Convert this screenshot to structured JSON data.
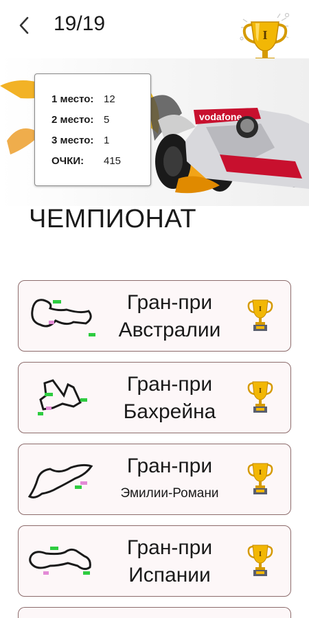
{
  "header": {
    "counter": "19/19"
  },
  "stats": [
    {
      "label": "1 место:",
      "value": "12"
    },
    {
      "label": "2 место:",
      "value": "5"
    },
    {
      "label": "3 место:",
      "value": "1"
    },
    {
      "label": "ОЧКИ:",
      "value": "415"
    }
  ],
  "hero": {
    "car_text": "vodafone"
  },
  "title": "ЧЕМПИОНАТ",
  "trophy_numeral": "I",
  "races": [
    {
      "line1": "Гран-при",
      "line2": "Австралии"
    },
    {
      "line1": "Гран-при",
      "line2": "Бахрейна"
    },
    {
      "line1": "Гран-при",
      "line2": "Эмилии-Романи"
    },
    {
      "line1": "Гран-при",
      "line2": "Испании"
    }
  ],
  "colors": {
    "gold": "#f2b705",
    "card_border": "#8c6b6b",
    "car_red": "#c8102e"
  }
}
